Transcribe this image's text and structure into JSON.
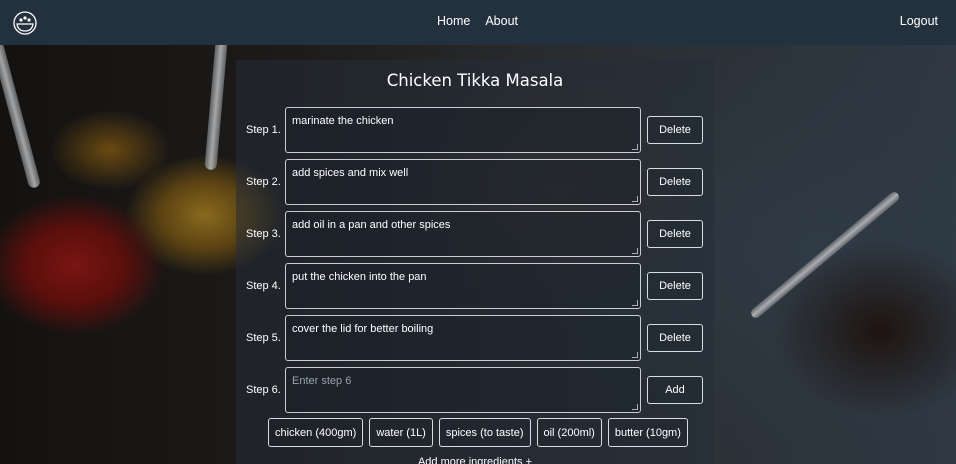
{
  "nav": {
    "links": [
      "Home",
      "About"
    ],
    "logout": "Logout",
    "logo_icon": "chef-bowl-icon"
  },
  "recipe": {
    "title": "Chicken Tikka Masala",
    "steps": [
      {
        "label": "Step 1.",
        "text": "marinate the chicken",
        "button": "Delete"
      },
      {
        "label": "Step 2.",
        "text": "add spices and mix well",
        "button": "Delete"
      },
      {
        "label": "Step 3.",
        "text": "add oil in a pan and other spices",
        "button": "Delete"
      },
      {
        "label": "Step 4.",
        "text": "put the chicken into the pan",
        "button": "Delete"
      },
      {
        "label": "Step 5.",
        "text": "cover the lid for better boiling",
        "button": "Delete"
      }
    ],
    "new_step": {
      "label": "Step 6.",
      "placeholder": "Enter step 6",
      "button": "Add"
    },
    "ingredients": [
      "chicken (400gm)",
      "water (1L)",
      "spices (to taste)",
      "oil (200ml)",
      "butter (10gm)"
    ],
    "add_more": "Add more ingredients +"
  }
}
